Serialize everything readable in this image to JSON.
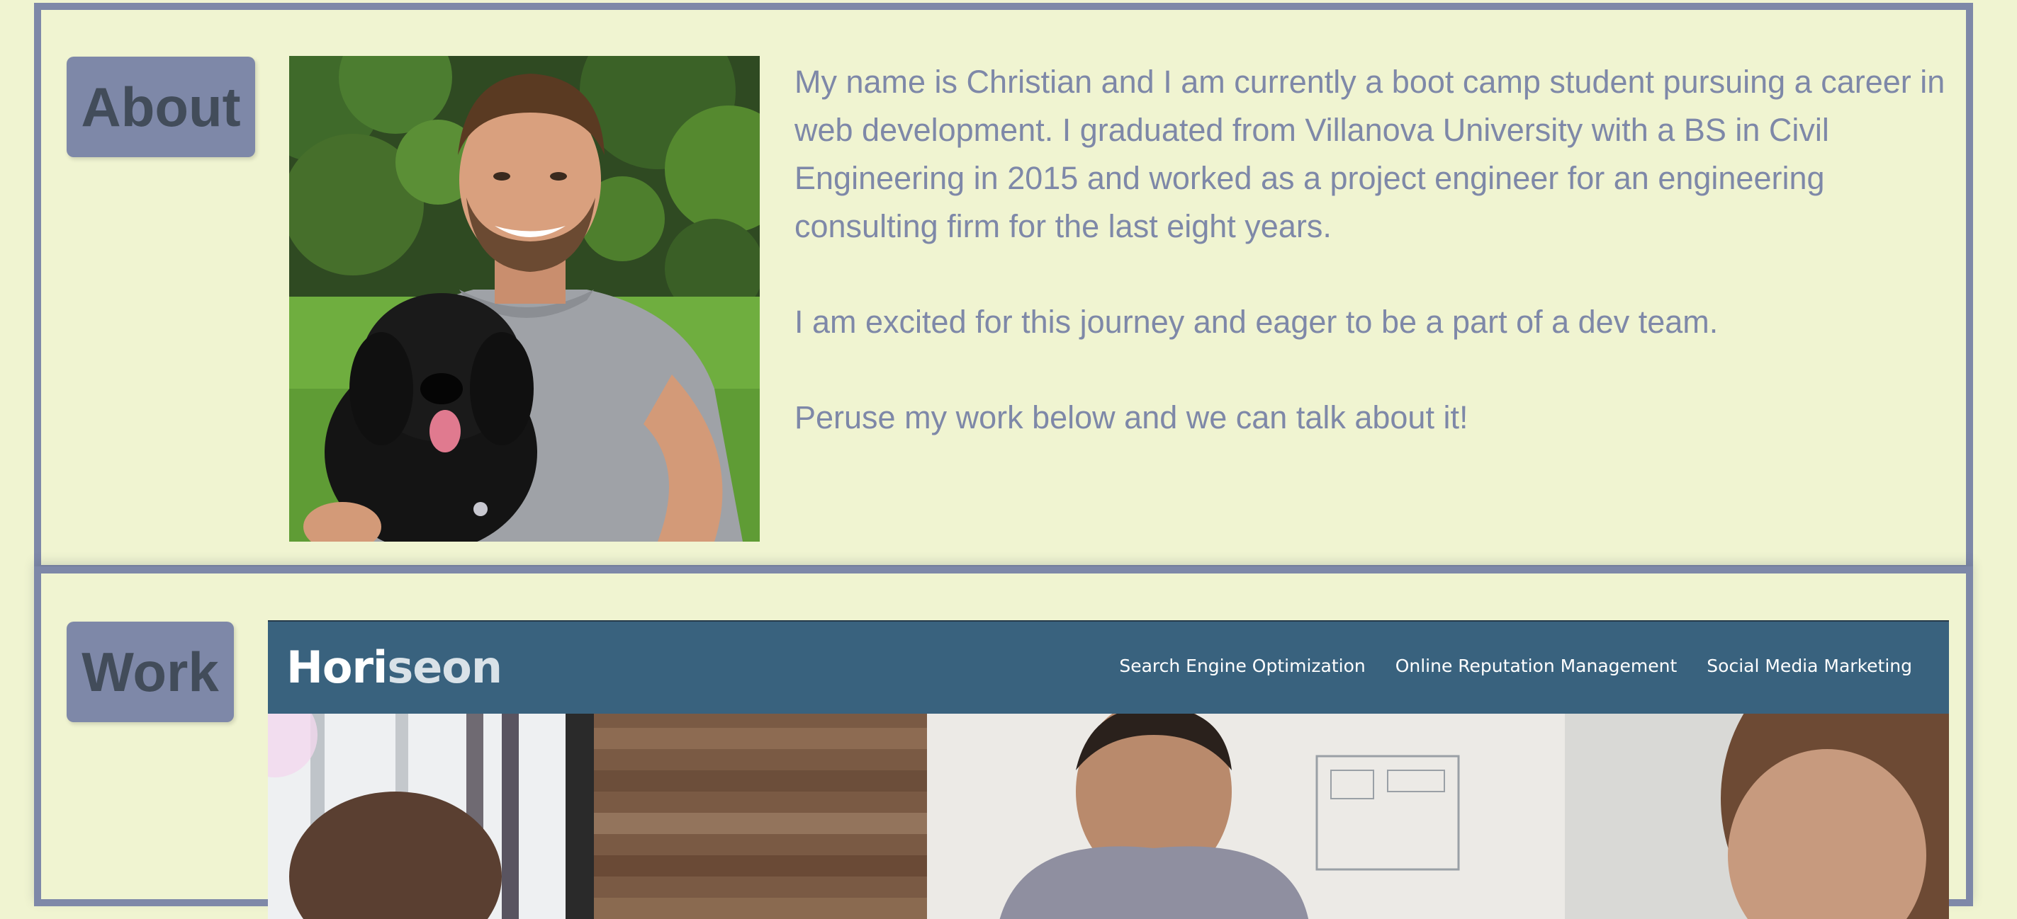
{
  "about": {
    "label": "About",
    "photo_alt": "Christian with his dog",
    "bio": [
      "My name is Christian and I am currently a boot camp student pursuing a career in web development. I graduated from Villanova University with a BS in Civil Engineering in 2015 and worked as a project engineer for an engineering consulting firm for the last eight years.",
      "I am excited for this journey and eager to be a part of a dev team.",
      "Peruse my work below and we can talk about it!"
    ]
  },
  "work": {
    "label": "Work",
    "project": {
      "logo_prefix": "Hori",
      "logo_suffix": "seon",
      "nav": [
        "Search Engine Optimization",
        "Online Reputation Management",
        "Social Media Marketing"
      ]
    }
  },
  "colors": {
    "background": "#f0f4d1",
    "accent": "#7e88a8",
    "label_text": "#424c5a",
    "project_header": "#39627e"
  }
}
